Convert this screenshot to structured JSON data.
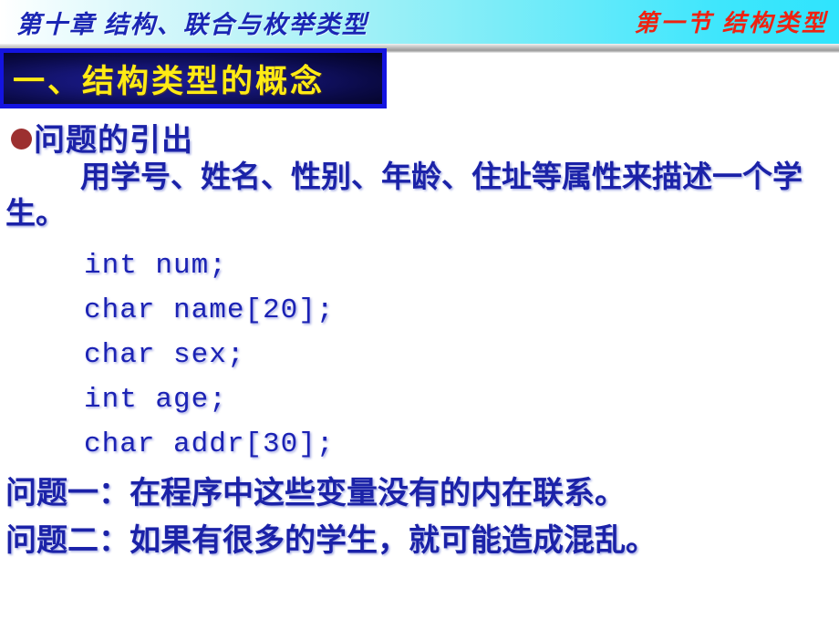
{
  "header": {
    "left_title": "第十章 结构、联合与枚举类型",
    "right_title": "第一节 结构类型",
    "left_color": "#1a26b4",
    "right_color": "#ee2211",
    "band_gradient_from": "#ffffff",
    "band_gradient_to": "#2fe4fd"
  },
  "section": {
    "title": "一、结构类型的概念",
    "title_color": "#ffeb14",
    "box_border_color": "#1414e0",
    "box_fill_color": "#0a0a46"
  },
  "content": {
    "bullet_marker": "filled-circle-bullet",
    "bullet_color": "#9c3030",
    "bullet_heading": "问题的引出",
    "paragraph": "用学号、姓名、性别、年龄、住址等属性来描述一个学生。",
    "text_color": "#1b22a8",
    "code_lines": [
      "int num;",
      "char name[20];",
      "char sex;",
      "int age;",
      "char addr[30];"
    ],
    "problems": [
      "问题一：在程序中这些变量没有的内在联系。",
      "问题二：如果有很多的学生，就可能造成混乱。"
    ]
  }
}
